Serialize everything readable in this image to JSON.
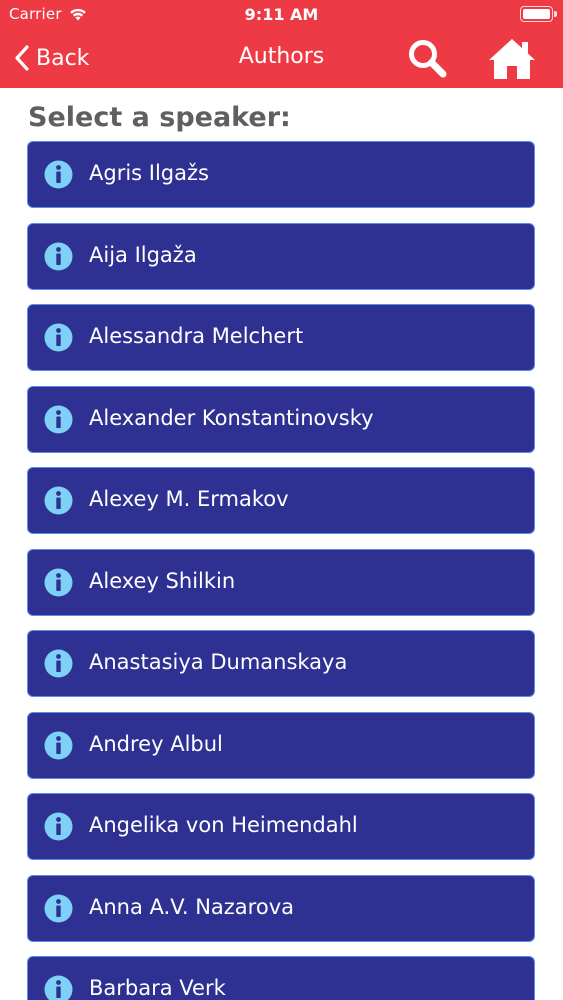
{
  "status_bar": {
    "carrier": "Carrier",
    "time": "9:11 AM"
  },
  "nav_bar": {
    "back_label": "Back",
    "title": "Authors",
    "accent_color": "#ee3a44"
  },
  "main": {
    "section_title": "Select a speaker:",
    "item_color": "#2e3192",
    "info_icon_color": "#7fd0f7",
    "speakers": [
      {
        "name": "Agris Ilgažs"
      },
      {
        "name": "Aija Ilgaža"
      },
      {
        "name": "Alessandra Melchert"
      },
      {
        "name": "Alexander Konstantinovsky"
      },
      {
        "name": "Alexey M. Ermakov"
      },
      {
        "name": "Alexey Shilkin"
      },
      {
        "name": "Anastasiya Dumanskaya"
      },
      {
        "name": "Andrey Albul"
      },
      {
        "name": "Angelika von Heimendahl"
      },
      {
        "name": "Anna A.V. Nazarova"
      },
      {
        "name": "Barbara Verk"
      }
    ]
  }
}
